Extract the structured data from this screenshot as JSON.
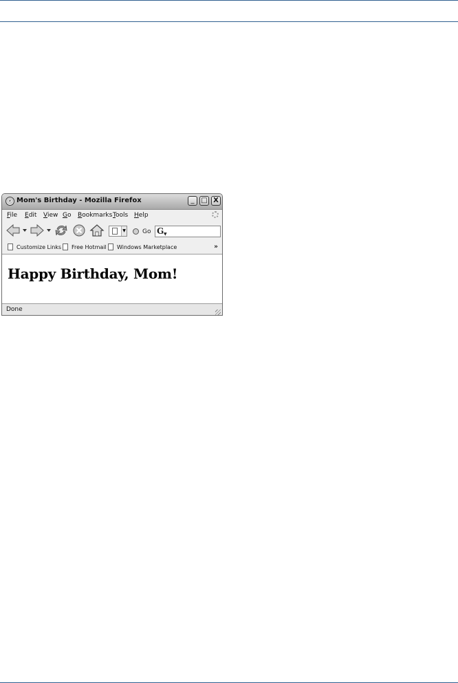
{
  "window": {
    "title": "Mom's Birthday - Mozilla Firefox",
    "controls": {
      "minimize": "_",
      "maximize": "□",
      "close": "X"
    }
  },
  "menu": [
    "File",
    "Edit",
    "View",
    "Go",
    "Bookmarks",
    "Tools",
    "Help"
  ],
  "navigation": {
    "go_label": "Go",
    "search_engine": "G"
  },
  "bookmarks": [
    "Customize Links",
    "Free Hotmail",
    "Windows Marketplace"
  ],
  "bookmarks_more": "»",
  "content": {
    "heading": "Happy Birthday, Mom!"
  },
  "status": {
    "text": "Done"
  },
  "icons": [
    "firefox-icon",
    "back-icon",
    "forward-icon",
    "reload-icon",
    "stop-icon",
    "home-icon",
    "page-icon",
    "go-icon",
    "search-engine-icon",
    "throbber-icon"
  ]
}
